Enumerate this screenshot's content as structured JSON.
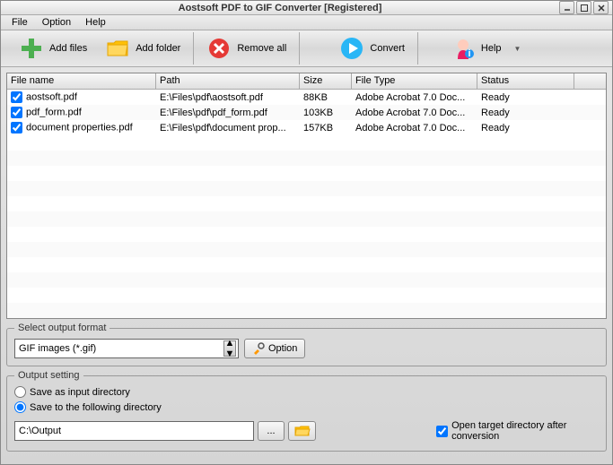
{
  "window": {
    "title": "Aostsoft PDF to GIF Converter [Registered]"
  },
  "menu": {
    "file": "File",
    "option": "Option",
    "help": "Help"
  },
  "toolbar": {
    "addfiles": "Add files",
    "addfolder": "Add folder",
    "removeall": "Remove all",
    "convert": "Convert",
    "help": "Help"
  },
  "columns": {
    "filename": "File name",
    "path": "Path",
    "size": "Size",
    "filetype": "File Type",
    "status": "Status"
  },
  "rows": [
    {
      "checked": true,
      "filename": "aostsoft.pdf",
      "path": "E:\\Files\\pdf\\aostsoft.pdf",
      "size": "88KB",
      "filetype": "Adobe Acrobat 7.0 Doc...",
      "status": "Ready"
    },
    {
      "checked": true,
      "filename": "pdf_form.pdf",
      "path": "E:\\Files\\pdf\\pdf_form.pdf",
      "size": "103KB",
      "filetype": "Adobe Acrobat 7.0 Doc...",
      "status": "Ready"
    },
    {
      "checked": true,
      "filename": "document properties.pdf",
      "path": "E:\\Files\\pdf\\document prop...",
      "size": "157KB",
      "filetype": "Adobe Acrobat 7.0 Doc...",
      "status": "Ready"
    }
  ],
  "outputformat": {
    "legend": "Select output format",
    "selected": "GIF images (*.gif)",
    "option_btn": "Option"
  },
  "outputsetting": {
    "legend": "Output setting",
    "save_input": "Save as input directory",
    "save_following": "Save to the following directory",
    "path": "C:\\Output",
    "open_target": "Open target directory after conversion"
  }
}
